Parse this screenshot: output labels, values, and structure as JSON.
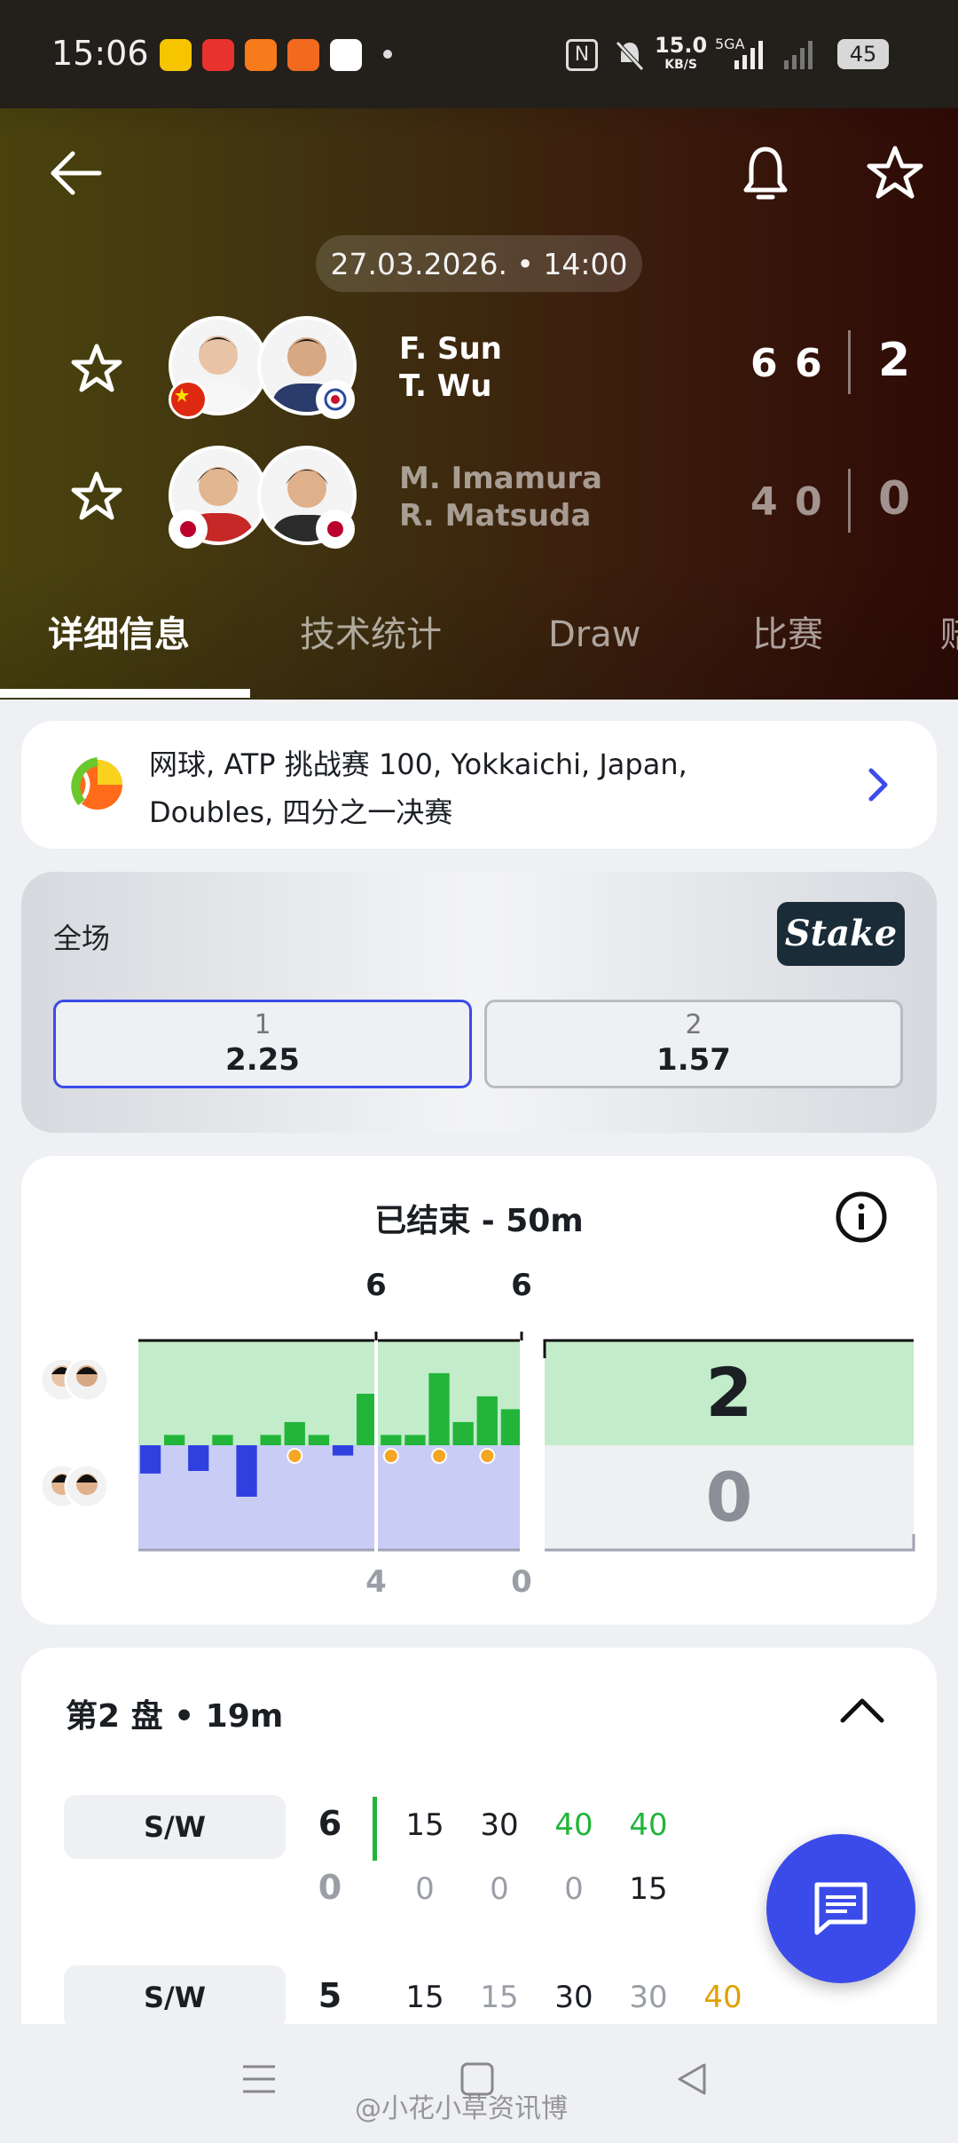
{
  "status_bar": {
    "time": "15:06",
    "net_speed": "15.0",
    "net_unit": "KB/S",
    "battery": "45",
    "signal_label": "5GA"
  },
  "header": {
    "date_time": "27.03.2026. • 14:00",
    "team1": {
      "players": [
        "F. Sun",
        "T. Wu"
      ],
      "set_scores": [
        "6",
        "6"
      ],
      "sets_won": "2"
    },
    "team2": {
      "players": [
        "M. Imamura",
        "R. Matsuda"
      ],
      "set_scores": [
        "4",
        "0"
      ],
      "sets_won": "0"
    },
    "tabs": [
      "详细信息",
      "技术统计",
      "Draw",
      "比赛",
      "赔"
    ]
  },
  "tournament": {
    "line1": "网球, ATP 挑战赛 100, Yokkaichi, Japan,",
    "line2": "Doubles, 四分之一决赛"
  },
  "odds": {
    "market": "全场",
    "bookmaker": "Stake",
    "options": [
      {
        "label": "1",
        "value": "2.25"
      },
      {
        "label": "2",
        "value": "1.57"
      }
    ]
  },
  "momentum": {
    "title": "已结束 - 50m",
    "set_top_labels": [
      "6",
      "6"
    ],
    "set_bottom_labels": [
      "4",
      "0"
    ],
    "final": {
      "team1": "2",
      "team2": "0"
    },
    "bars": [
      -0.55,
      0.2,
      -0.5,
      0.2,
      -1.0,
      0.2,
      0.45,
      0.2,
      -0.2,
      1.0,
      0.2,
      0.2,
      1.4,
      0.45,
      0.95,
      0.7
    ],
    "team1_color": "#22b53a",
    "team2_color": "#3040e0"
  },
  "set_detail": {
    "title": "第2 盘 • 19m",
    "rows": [
      {
        "chip": "S/W",
        "game_top": "6",
        "game_bottom": "0",
        "points_top": [
          "15",
          "30",
          "40",
          "40"
        ],
        "points_bottom": [
          "0",
          "0",
          "0",
          "15"
        ]
      },
      {
        "chip": "S/W",
        "game_top": "5",
        "points_top": [
          "15",
          "15",
          "30",
          "30",
          "40"
        ]
      }
    ]
  },
  "watermark": "@小花小草资讯博"
}
